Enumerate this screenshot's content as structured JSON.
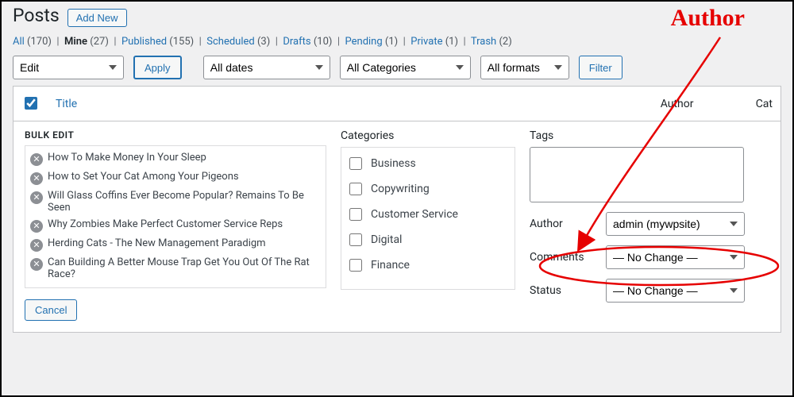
{
  "page": {
    "title": "Posts",
    "add_new": "Add New"
  },
  "filters_row": {
    "all": {
      "label": "All",
      "count": "(170)"
    },
    "mine": {
      "label": "Mine",
      "count": "(27)"
    },
    "published": {
      "label": "Published",
      "count": "(155)"
    },
    "scheduled": {
      "label": "Scheduled",
      "count": "(3)"
    },
    "drafts": {
      "label": "Drafts",
      "count": "(10)"
    },
    "pending": {
      "label": "Pending",
      "count": "(1)"
    },
    "private": {
      "label": "Private",
      "count": "(1)"
    },
    "trash": {
      "label": "Trash",
      "count": "(2)"
    }
  },
  "toolbar": {
    "bulk_action": "Edit",
    "apply": "Apply",
    "dates": "All dates",
    "categories": "All Categories",
    "formats": "All formats",
    "filter": "Filter"
  },
  "columns": {
    "title": "Title",
    "author": "Author",
    "categories": "Cat"
  },
  "bulk_edit": {
    "heading": "BULK EDIT",
    "categories_label": "Categories",
    "tags_label": "Tags",
    "author_label": "Author",
    "comments_label": "Comments",
    "status_label": "Status",
    "author_value": "admin (mywpsite)",
    "no_change": "— No Change —",
    "cancel": "Cancel",
    "posts": [
      "How To Make Money In Your Sleep",
      "How to Set Your Cat Among Your Pigeons",
      "Will Glass Coffins Ever Become Popular? Remains To Be Seen",
      "Why Zombies Make Perfect Customer Service Reps",
      "Herding Cats - The New Management Paradigm",
      "Can Building A Better Mouse Trap Get You Out Of The Rat Race?"
    ],
    "categories": [
      "Business",
      "Copywriting",
      "Customer Service",
      "Digital",
      "Finance"
    ]
  },
  "annotation": {
    "label": "Author"
  }
}
